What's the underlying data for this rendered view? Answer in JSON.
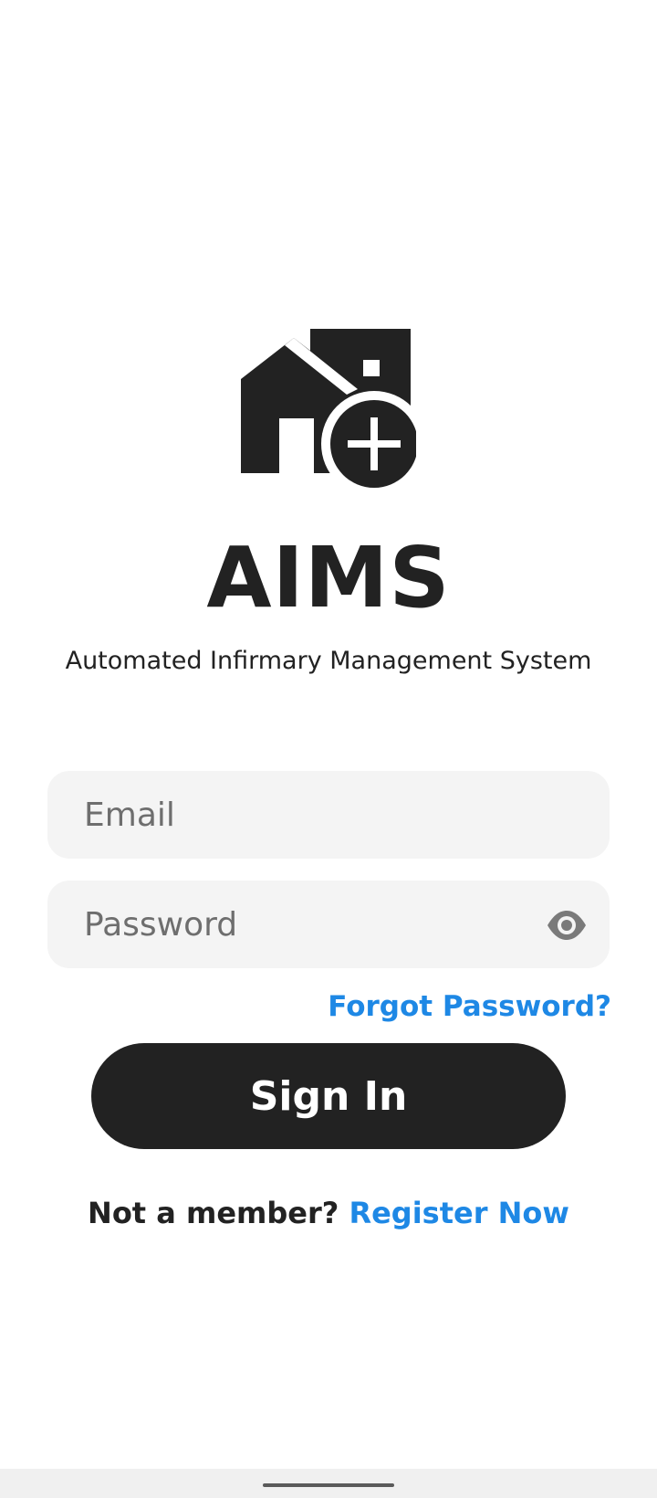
{
  "app": {
    "title": "AIMS",
    "subtitle": "Automated Infirmary Management System",
    "logo_icon": "house-medical-icon"
  },
  "form": {
    "email_placeholder": "Email",
    "email_value": "",
    "password_placeholder": "Password",
    "password_value": "",
    "visibility_icon": "eye-icon",
    "forgot_label": "Forgot Password?",
    "signin_label": "Sign In",
    "register_prompt": "Not a member?",
    "register_link": "Register Now"
  },
  "colors": {
    "primary": "#222222",
    "accent": "#1e88e5",
    "field_bg": "#f4f4f4",
    "background": "#ffffff"
  }
}
